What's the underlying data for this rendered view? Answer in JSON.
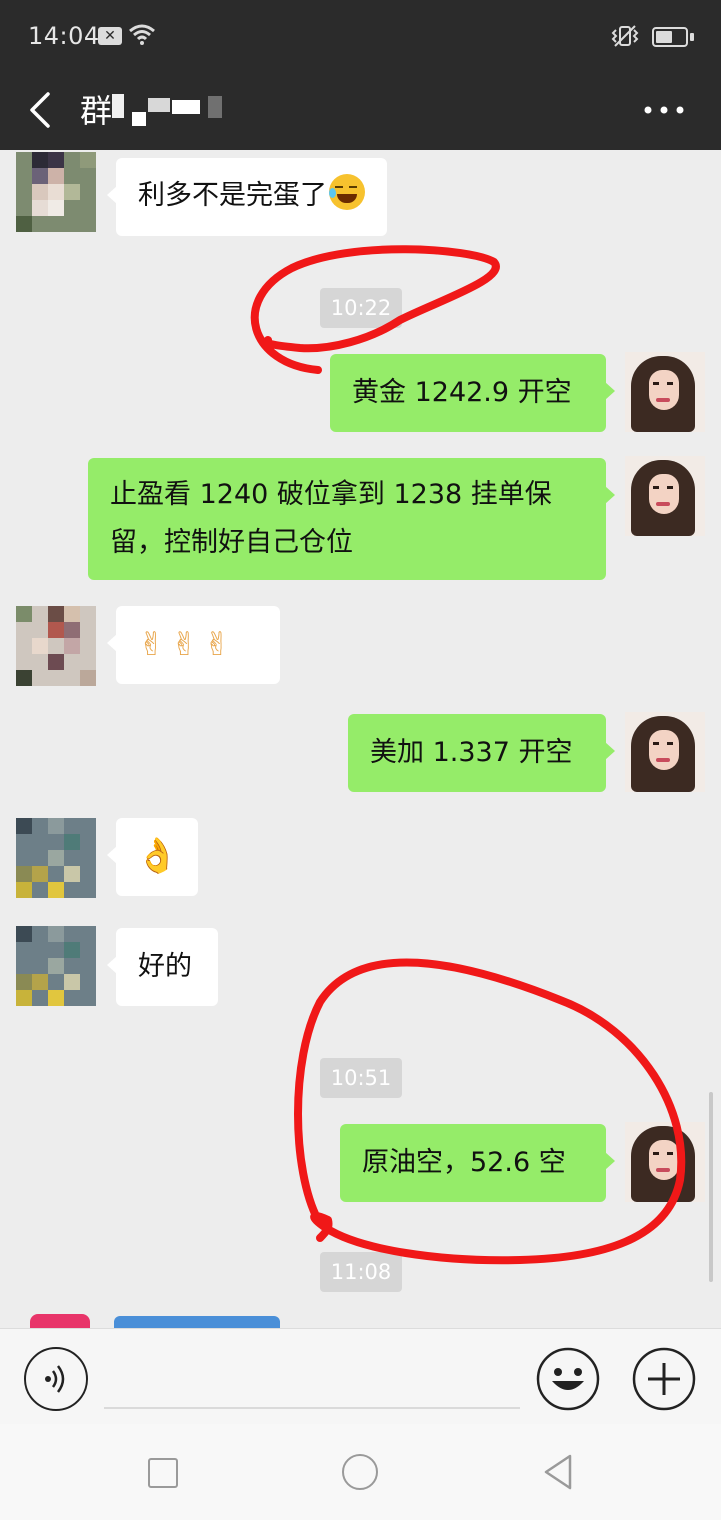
{
  "status_bar": {
    "time": "14:04",
    "notification_icon": "x-box-icon",
    "wifi_icon": "wifi-icon",
    "vibrate_icon": "vibrate-icon",
    "battery_icon": "battery-icon",
    "battery_level": 0.45
  },
  "header": {
    "title": "群",
    "back_icon": "chevron-left-icon",
    "more_icon": "more-dots-icon"
  },
  "messages": [
    {
      "side": "left",
      "sender": "other-member-1",
      "text": "利多不是完蛋了",
      "emoji": "rolling-laughing-emoji"
    },
    {
      "type": "timestamp",
      "text": "10:22"
    },
    {
      "side": "right",
      "sender": "me",
      "text": "黄金 1242.9 开空"
    },
    {
      "side": "right",
      "sender": "me",
      "text_line1": "止盈看 1240 破位拿到 1238 挂单保",
      "text_line2": "留，控制好自己仓位"
    },
    {
      "side": "left",
      "sender": "other-member-2",
      "text": "",
      "emoji": "victory-hand-emoji x3"
    },
    {
      "side": "right",
      "sender": "me",
      "text": "美加 1.337 开空"
    },
    {
      "side": "left",
      "sender": "other-member-3",
      "text": "",
      "emoji": "ok-hand-emoji"
    },
    {
      "side": "left",
      "sender": "other-member-3",
      "text": "好的"
    },
    {
      "type": "timestamp",
      "text": "10:51"
    },
    {
      "side": "right",
      "sender": "me",
      "text": "原油空，52.6 空"
    },
    {
      "type": "timestamp",
      "text": "11:08"
    }
  ],
  "input_bar": {
    "voice_icon": "voice-icon",
    "input_value": "",
    "emoji_icon": "smiley-icon",
    "plus_icon": "plus-icon"
  },
  "nav_bar": {
    "recent_icon": "square-icon",
    "home_icon": "circle-icon",
    "back_icon": "triangle-back-icon"
  },
  "colors": {
    "header_bg": "#2b2b2b",
    "chat_bg": "#ededed",
    "bubble_me": "#95ec69",
    "bubble_other": "#ffffff",
    "annotation_red": "#f01818"
  }
}
